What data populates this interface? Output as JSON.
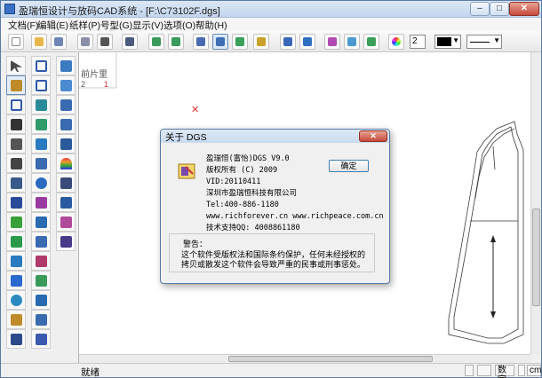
{
  "window": {
    "title": "盈瑞恒设计与放码CAD系统 - [F:\\C73102F.dgs]",
    "minimize_glyph": "–",
    "maximize_glyph": "□",
    "close_glyph": "✕"
  },
  "menu": [
    "文档(F)",
    "编辑(E)",
    "纸样(P)",
    "号型(G)",
    "显示(V)",
    "选项(O)",
    "帮助(H)"
  ],
  "toolbar": {
    "pen_width_value": "2",
    "color_selected": "#000000",
    "line_style": "solid"
  },
  "canvas": {
    "piece_label": "前片里",
    "piece_numbers": [
      "2",
      "1"
    ],
    "cross_mark": "✕"
  },
  "dialog": {
    "title": "关于 DGS",
    "close_glyph": "✕",
    "ok_label": "确定",
    "product": "盈瑞恒(富怡)DGS V9.0",
    "copyright": "版权所有 (C) 2009",
    "vid": "VID:20110411",
    "company": "深圳市盈瑞恒科技有限公司",
    "tel": "Tel:400-886-1180",
    "websites": "www.richforever.cn  www.richpeace.com.cn",
    "support_qq": "技术支持QQ: 4008861180",
    "warning_title": "警告：",
    "warning_text": "这个软件受版权法和国际条约保护，任何未经授权的拷贝或散发这个软件会导致严重的民事或刑事惩处。"
  },
  "status": {
    "ready": "就绪",
    "mode": "数字",
    "unit": "cm"
  },
  "colors": {
    "title_gradient": "#c3d6ee",
    "close_red": "#c6493a",
    "piece_red": "#e03030",
    "pattern_stroke": "#3a3a3a"
  }
}
